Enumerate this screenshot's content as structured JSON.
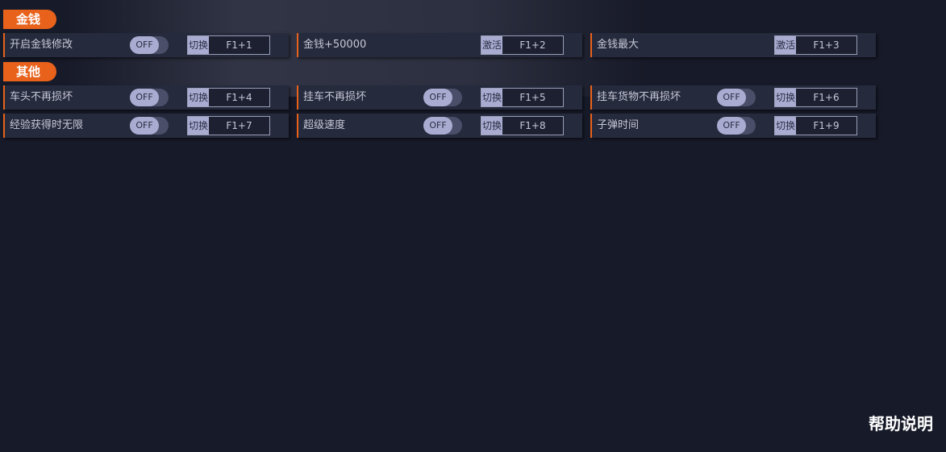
{
  "sections": [
    {
      "title": "金钱",
      "rows": [
        [
          {
            "label": "开启金钱修改",
            "toggle": "OFF",
            "mode": "切换",
            "key": "F1+1"
          },
          {
            "label": "金钱+50000",
            "toggle": null,
            "mode": "激活",
            "key": "F1+2"
          },
          {
            "label": "金钱最大",
            "toggle": null,
            "mode": "激活",
            "key": "F1+3"
          }
        ]
      ]
    },
    {
      "title": "其他",
      "rows": [
        [
          {
            "label": "车头不再损坏",
            "toggle": "OFF",
            "mode": "切换",
            "key": "F1+4"
          },
          {
            "label": "挂车不再损坏",
            "toggle": "OFF",
            "mode": "切换",
            "key": "F1+5"
          },
          {
            "label": "挂车货物不再损坏",
            "toggle": "OFF",
            "mode": "切换",
            "key": "F1+6"
          }
        ],
        [
          {
            "label": "经验获得时无限",
            "toggle": "OFF",
            "mode": "切换",
            "key": "F1+7"
          },
          {
            "label": "超级速度",
            "toggle": "OFF",
            "mode": "切换",
            "key": "F1+8"
          },
          {
            "label": "子弹时间",
            "toggle": "OFF",
            "mode": "切换",
            "key": "F1+9"
          }
        ]
      ]
    }
  ],
  "help_label": "帮助说明",
  "colors": {
    "accent": "#e8621c",
    "background": "#171a28",
    "row_bg": "#262a3d",
    "toggle_knob": "#a9acd0"
  }
}
